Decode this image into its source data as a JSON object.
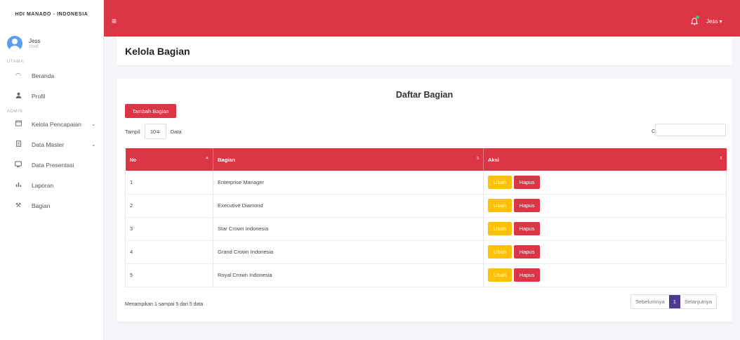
{
  "sidebar": {
    "brand": "HDI MANADO - INDONESIA",
    "user": {
      "name": "Jess",
      "id": "12345"
    },
    "sections": {
      "utama": "UTAMA",
      "admin": "ADMIN"
    },
    "items": [
      {
        "label": "Beranda",
        "icon": "gauge-icon"
      },
      {
        "label": "Profil",
        "icon": "user-icon"
      },
      {
        "label": "Kelola Pencapaian",
        "icon": "window-icon",
        "chevron": "⌄"
      },
      {
        "label": "Data Master",
        "icon": "document-icon",
        "chevron": "⌄"
      },
      {
        "label": "Data Presentasi",
        "icon": "monitor-icon"
      },
      {
        "label": "Laporan",
        "icon": "bar-chart-icon"
      },
      {
        "label": "Bagian",
        "icon": "tools-icon"
      }
    ]
  },
  "topbar": {
    "user_label": "Jess ▾",
    "accent": "#dc3545"
  },
  "page": {
    "title": "Kelola Bagian"
  },
  "card": {
    "title": "Daftar Bagian",
    "add_button": "Tambah Bagian",
    "show_prefix": "Tampil",
    "show_value": "10≑",
    "show_suffix": "Data",
    "search_label": "Cari",
    "search_value": ""
  },
  "table": {
    "headers": [
      "No",
      "Bagian",
      "Aksi"
    ],
    "rows": [
      {
        "no": "1",
        "bagian": "Enterprise Manager"
      },
      {
        "no": "2",
        "bagian": "Executive Diamond"
      },
      {
        "no": "3",
        "bagian": "Star Crown Indonesia"
      },
      {
        "no": "4",
        "bagian": "Grand Crown Indonesia"
      },
      {
        "no": "5",
        "bagian": "Royal Crown Indonesia"
      }
    ],
    "edit_label": "Ubah",
    "delete_label": "Hapus"
  },
  "footer": {
    "info": "Menampikan 1 sampai 5 dari 5 data",
    "prev": "Sebelumnya",
    "page": "1",
    "next": "Selanjutnya"
  }
}
